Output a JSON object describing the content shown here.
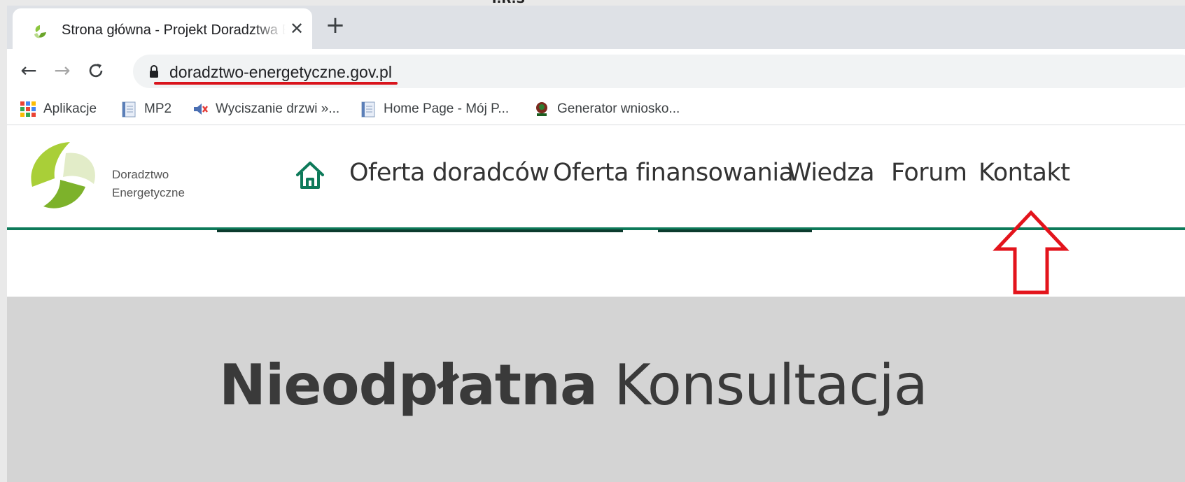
{
  "overlay": {
    "label": "T.R.S"
  },
  "browser": {
    "tab": {
      "title": "Strona główna - Projekt Doradztwa Energetycznego",
      "close": "✕"
    },
    "new_tab": "+",
    "nav": {
      "back": "←",
      "forward": "→",
      "reload": "C"
    },
    "address": {
      "url": "doradztwo-energetyczne.gov.pl"
    },
    "bookmarks": [
      {
        "label": "Aplikacje",
        "icon": "apps-grid-icon"
      },
      {
        "label": "MP2",
        "icon": "document-icon"
      },
      {
        "label": "Wyciszanie drzwi »...",
        "icon": "muted-speaker-icon"
      },
      {
        "label": "Home Page - Mój P...",
        "icon": "document-icon"
      },
      {
        "label": "Generator wniosko...",
        "icon": "emblem-icon"
      }
    ]
  },
  "site": {
    "logo_text": {
      "line1": "Doradztwo",
      "line2": "Energetyczne"
    },
    "nav": [
      {
        "label": "Oferta doradców"
      },
      {
        "label": "Oferta finansowania"
      },
      {
        "label": "Wiedza"
      },
      {
        "label": "Forum"
      },
      {
        "label": "Kontakt"
      }
    ],
    "hero": {
      "bold": "Nieodpłatna",
      "light": "Konsultacja"
    }
  },
  "colors": {
    "accent": "#0e7a5a",
    "annotation": "#e3141c",
    "logo_green": "#8cc63e"
  }
}
